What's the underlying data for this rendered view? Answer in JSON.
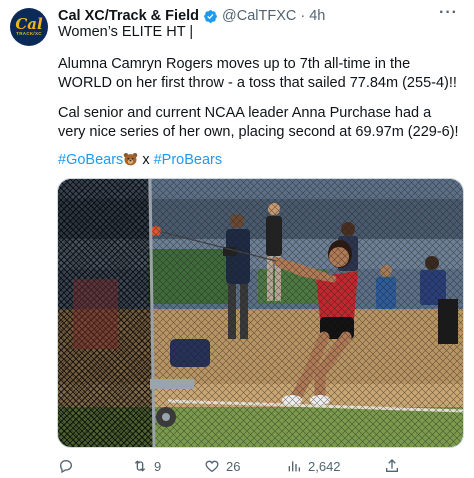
{
  "author": {
    "avatar_text": "Cal",
    "avatar_subtext": "TRACK/XC",
    "name": "Cal XC/Track & Field",
    "handle": "@CalTFXC",
    "separator": "·",
    "time": "4h"
  },
  "more_icon": "more-horizontal-icon",
  "tweet": {
    "line1": "Women’s ELITE HT |",
    "para1": "Alumna Camryn Rogers moves up to 7th all-time in the WORLD on her first throw - a toss that sailed 77.84m (255-4)!!",
    "para2": "Cal senior and current NCAA leader Anna Purchase had a very nice series of her own, placing second at 69.97m (229-6)!",
    "hashtag1": "#GoBears",
    "connector": " x ",
    "hashtag2": "#ProBears"
  },
  "media": {
    "description_icon": "photo"
  },
  "actions": {
    "reply_count": "",
    "retweet_count": "9",
    "like_count": "26",
    "views_count": "2,642"
  },
  "colors": {
    "accent": "#1d9bf0",
    "verified": "#1d9bf0",
    "avatar_bg": "#0b2a57",
    "avatar_fg": "#f2b31d",
    "muted": "#536471"
  }
}
